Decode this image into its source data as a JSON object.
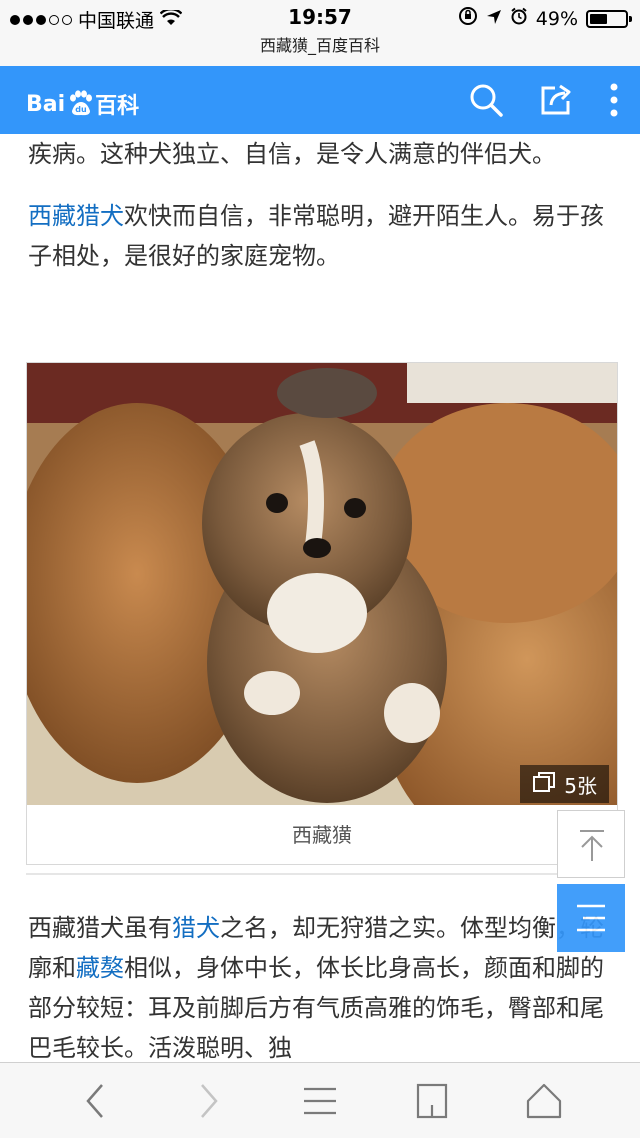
{
  "status_bar": {
    "carrier": "中国联通",
    "time": "19:57",
    "battery_percent": "49%",
    "battery_level": 0.49
  },
  "url_bar": {
    "title": "西藏獚_百度百科"
  },
  "header": {
    "logo_prefix": "Bai",
    "logo_suffix": "百科",
    "brand_color": "#3396fa"
  },
  "article": {
    "para1": "疾病。这种犬独立、自信，是令人满意的伴侣犬。",
    "para2_link": "西藏猎犬",
    "para2_text": "欢快而自信，非常聪明，避开陌生人。易于孩子相处，是很好的家庭宠物。",
    "para3_a": "西藏猎犬虽有",
    "para3_link1": "猎犬",
    "para3_b": "之名，却无狩猎之实。体型均衡，轮廓和",
    "para3_link2": "藏獒",
    "para3_c": "相似，身体中长，体长比身高长，颜面和脚的部分较短：耳及前脚后方有气质高雅的饰毛，臀部和尾巴毛较长。活泼聪明、独"
  },
  "photo": {
    "count": "5张",
    "caption": "西藏獚"
  },
  "colors": {
    "link": "#136ec2",
    "text": "#333333"
  }
}
